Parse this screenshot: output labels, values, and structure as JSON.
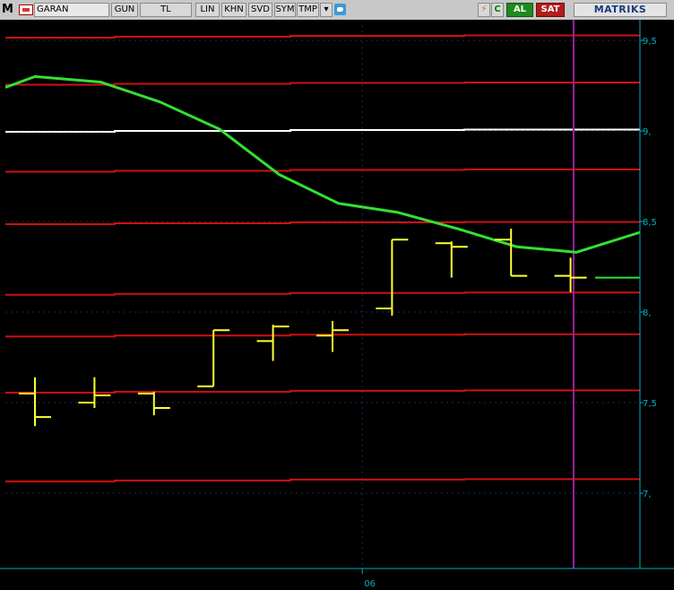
{
  "toolbar": {
    "m_label": "M",
    "symbol_value": "GARAN",
    "period_label": "GUN",
    "currency_label": "TL",
    "lin_label": "LIN",
    "khn_label": "KHN",
    "svd_label": "SVD",
    "sym_label": "SYM",
    "tmp_label": "TMP",
    "dropdown_glyph": "▾",
    "lightning_glyph": "⚡",
    "refresh_glyph": "C",
    "buy_label": "AL",
    "sell_label": "SAT",
    "brand": "MATRIKS"
  },
  "colors": {
    "background": "#000000",
    "level_line": "#d01010",
    "white_line": "#ffffff",
    "moving_average": "#33e033",
    "bars": "#ffff33",
    "cursor": "#a020a0",
    "axis": "#00b0c0"
  },
  "chart_data": {
    "type": "ohlc",
    "x_tick_labels": [
      "06"
    ],
    "x_tick_index": 5.5,
    "y_tick_labels": [
      "9,5",
      "9,",
      "8,5",
      "8,",
      "7,5",
      "7,"
    ],
    "y_ticks": [
      9.5,
      9.0,
      8.5,
      8.0,
      7.5,
      7.0
    ],
    "ylim": [
      6.8,
      9.7
    ],
    "bars": [
      {
        "open": 7.55,
        "high": 7.64,
        "low": 7.37,
        "close": 7.42
      },
      {
        "open": 7.5,
        "high": 7.64,
        "low": 7.47,
        "close": 7.54
      },
      {
        "open": 7.55,
        "high": 7.56,
        "low": 7.43,
        "close": 7.47
      },
      {
        "open": 7.59,
        "high": 7.9,
        "low": 7.59,
        "close": 7.9
      },
      {
        "open": 7.84,
        "high": 7.93,
        "low": 7.73,
        "close": 7.92
      },
      {
        "open": 7.87,
        "high": 7.95,
        "low": 7.78,
        "close": 7.9
      },
      {
        "open": 8.02,
        "high": 8.4,
        "low": 7.98,
        "close": 8.4
      },
      {
        "open": 8.38,
        "high": 8.39,
        "low": 8.19,
        "close": 8.36
      },
      {
        "open": 8.4,
        "high": 8.46,
        "low": 8.2,
        "close": 8.2
      },
      {
        "open": 8.2,
        "high": 8.3,
        "low": 8.11,
        "close": 8.19
      }
    ],
    "moving_average": [
      {
        "i": -0.6,
        "v": 9.24
      },
      {
        "i": 0.0,
        "v": 9.3
      },
      {
        "i": 1.1,
        "v": 9.27
      },
      {
        "i": 2.1,
        "v": 9.16
      },
      {
        "i": 3.1,
        "v": 9.01
      },
      {
        "i": 4.1,
        "v": 8.76
      },
      {
        "i": 5.1,
        "v": 8.6
      },
      {
        "i": 6.1,
        "v": 8.55
      },
      {
        "i": 7.1,
        "v": 8.46
      },
      {
        "i": 8.1,
        "v": 8.36
      },
      {
        "i": 9.1,
        "v": 8.33
      },
      {
        "i": 10.3,
        "v": 8.44
      }
    ],
    "horizontal_levels": [
      {
        "color": "red",
        "v": 9.52
      },
      {
        "color": "red",
        "v": 9.26
      },
      {
        "color": "white",
        "v": 9.0
      },
      {
        "color": "red",
        "v": 8.78
      },
      {
        "color": "red",
        "v": 8.49
      },
      {
        "color": "red",
        "v": 8.1
      },
      {
        "color": "red",
        "v": 7.87
      },
      {
        "color": "red",
        "v": 7.56
      },
      {
        "color": "red",
        "v": 7.07
      }
    ],
    "last_price": 8.19,
    "cursor_index": 9.05
  }
}
